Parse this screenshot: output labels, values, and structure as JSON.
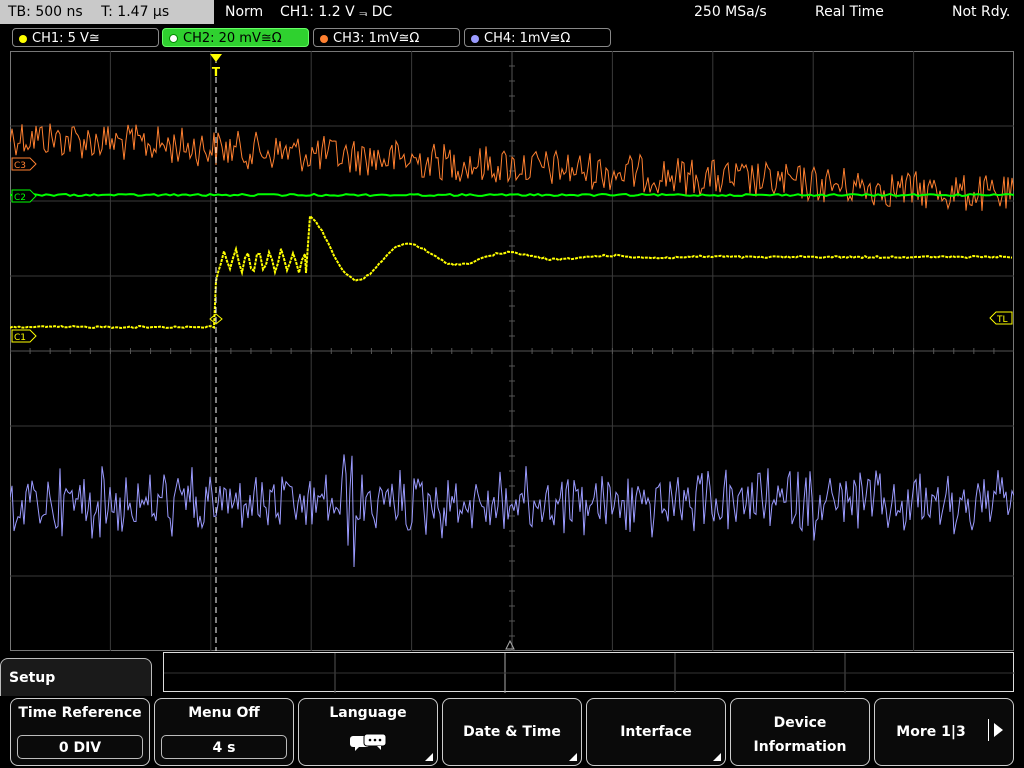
{
  "topbar": {
    "timebase": "TB: 500 ns",
    "trigger_time": "T: 1.47 µs",
    "mode": "Norm",
    "trigger": "CH1: 1.2 V ⫬ DC",
    "sample_rate": "250 MSa/s",
    "acq_mode": "Real Time",
    "status": "Not Rdy."
  },
  "channels": [
    {
      "label": "CH1: 5 V≅",
      "color": "#ffff00"
    },
    {
      "label": "CH2: 20 mV≅Ω",
      "color": "#00ff00",
      "active": true
    },
    {
      "label": "CH3: 1mV≅Ω",
      "color": "#ff8030"
    },
    {
      "label": "CH4: 1mV≅Ω",
      "color": "#9b9bff"
    }
  ],
  "markers": {
    "c3": "C3",
    "c2": "C2",
    "c1": "C1",
    "trigger_level": "TL",
    "trigger_point": "T"
  },
  "menu": {
    "title": "Setup",
    "time_reference": {
      "title": "Time Reference",
      "value": "0 DIV"
    },
    "menu_off": {
      "title": "Menu Off",
      "value": "4 s"
    },
    "language": {
      "title": "Language"
    },
    "date_time": {
      "title": "Date & Time"
    },
    "interface": {
      "title": "Interface"
    },
    "device_info": {
      "line1": "Device",
      "line2": "Information"
    },
    "more": {
      "title": "More 1|3"
    }
  },
  "colors": {
    "ch1": "#ffff00",
    "ch2": "#00ff00",
    "ch3": "#ff8030",
    "ch4": "#9b9bff",
    "grid": "#3a3a3a"
  },
  "icons": {
    "language": "speech-bubbles-icon",
    "submenu": "corner-triangle-icon",
    "more": "right-arrow-icon"
  }
}
